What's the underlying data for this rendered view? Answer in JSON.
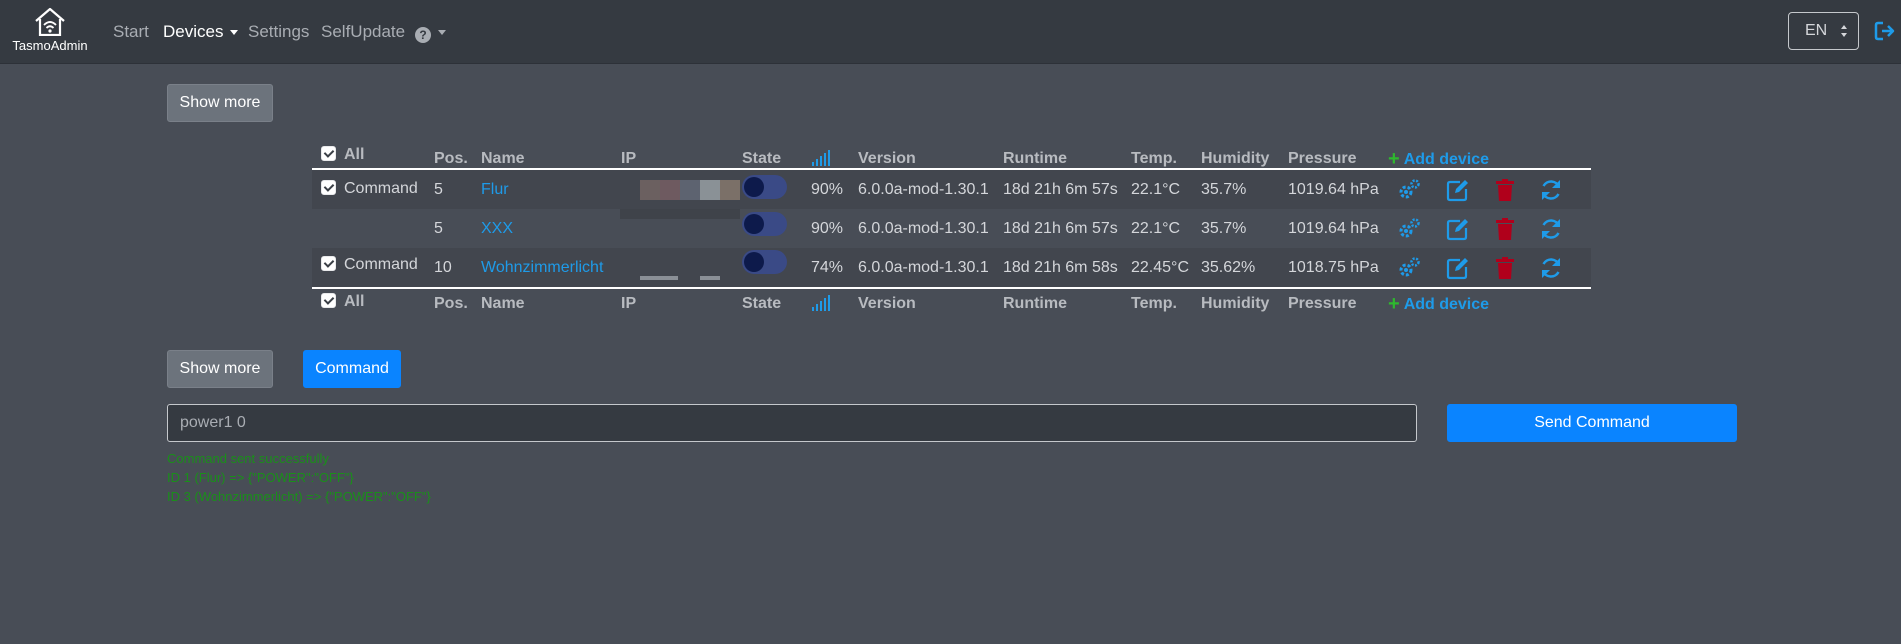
{
  "nav": {
    "brand": "TasmoAdmin",
    "links": [
      {
        "label": "Start",
        "active": false
      },
      {
        "label": "Devices",
        "active": true,
        "dropdown": true
      },
      {
        "label": "Settings",
        "active": false
      },
      {
        "label": "SelfUpdate",
        "active": false
      }
    ],
    "help_icon": "question-circle-icon",
    "lang": "EN",
    "logout_icon": "sign-out-icon"
  },
  "buttons": {
    "show_more_top": "Show more",
    "show_more_bottom": "Show more",
    "command": "Command",
    "send_command": "Send Command"
  },
  "table": {
    "headers": {
      "all": "All",
      "pos": "Pos.",
      "name": "Name",
      "ip": "IP",
      "state": "State",
      "signal_icon": "wifi-signal-icon",
      "version": "Version",
      "runtime": "Runtime",
      "temp": "Temp.",
      "humidity": "Humidity",
      "pressure": "Pressure",
      "add_device": "Add device"
    },
    "rows": [
      {
        "checked": true,
        "command": "Command",
        "pos": "5",
        "name": "Flur",
        "signal": "90%",
        "version": "6.0.0a-mod-1.30.1",
        "runtime": "18d 21h 6m 57s",
        "temp": "22.1°C",
        "humidity": "35.7%",
        "pressure": "1019.64 hPa"
      },
      {
        "checked": false,
        "command": "",
        "pos": "5",
        "name": "XXX",
        "signal": "90%",
        "version": "6.0.0a-mod-1.30.1",
        "runtime": "18d 21h 6m 57s",
        "temp": "22.1°C",
        "humidity": "35.7%",
        "pressure": "1019.64 hPa"
      },
      {
        "checked": true,
        "command": "Command",
        "pos": "10",
        "name": "Wohnzimmerlicht",
        "signal": "74%",
        "version": "6.0.0a-mod-1.30.1",
        "runtime": "18d 21h 6m 58s",
        "temp": "22.45°C",
        "humidity": "35.62%",
        "pressure": "1018.75 hPa"
      }
    ]
  },
  "command_input": {
    "value": "power1 0"
  },
  "log": [
    "Command sent successfully",
    "ID 1 (Flur) => {\"POWER\":\"OFF\"}",
    "ID 3 (Wohnzimmerlicht) => {\"POWER\":\"OFF\"}"
  ],
  "colors": {
    "background": "#484d56",
    "navbar": "#353a41",
    "accent_blue": "#0a84ff",
    "link_blue": "#1e9be9",
    "delete_red": "#b0001b",
    "success_green": "#1a8f1a"
  }
}
